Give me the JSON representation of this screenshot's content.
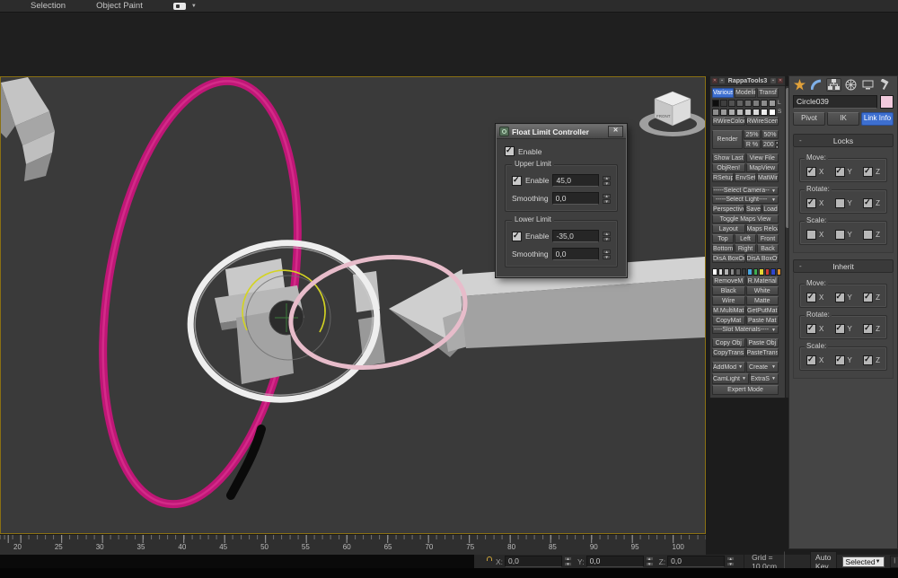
{
  "window": {
    "top_tabs": [
      "Selection",
      "Object Paint"
    ]
  },
  "icons": {
    "close": "✕",
    "caret_down": "▼",
    "spin_up": "▲",
    "spin_down": "▼",
    "minus": "-",
    "goto_start": "|◀◀",
    "prev_frame": "◀",
    "dot": "▪"
  },
  "viewport": {
    "viewcube_label": "FRONT"
  },
  "dialog": {
    "title": "Float Limit Controller",
    "enable": {
      "label": "Enable",
      "checked": true
    },
    "upper": {
      "title": "Upper Limit",
      "enable_label": "Enable",
      "enable_checked": true,
      "limit_value": "45,0",
      "smoothing_label": "Smoothing",
      "smoothing_value": "0,0"
    },
    "lower": {
      "title": "Lower Limit",
      "enable_label": "Enable",
      "enable_checked": true,
      "limit_value": "-35,0",
      "smoothing_label": "Smoothing",
      "smoothing_value": "0,0"
    }
  },
  "rappatools": {
    "title": "RappaTools3",
    "tabs": [
      {
        "label": "Various",
        "active": true
      },
      {
        "label": "Modeling",
        "active": false
      },
      {
        "label": "Transf",
        "active": false
      }
    ],
    "swatches_l": [
      "#0d0d0d",
      "#3f3f3f",
      "#525252",
      "#616161",
      "#6f6f6f",
      "#7d7d7d",
      "#8c8c8c",
      "#9b9b9b"
    ],
    "swatch_l_label": "L",
    "swatches_s": [
      "#8c8c8c",
      "#9b9b9b",
      "#ababab",
      "#bababa",
      "#cacaca",
      "#dadada",
      "#eeeeee",
      "#ffffff"
    ],
    "swatch_s_label": "S",
    "material_swatches": [
      "#ffffff",
      "#d9d9d9",
      "#b3b3b3",
      "#8c8c8c",
      "#5f5f5f",
      "#383838",
      "#4aa6dd",
      "#3fae53",
      "#e3d435",
      "#cf3a33",
      "#2f46cc",
      "#de8f2e"
    ],
    "buttons": {
      "rwirecolor": "RWireColor",
      "rwirescene": "RWireScene",
      "render": "Render",
      "p25": "25%",
      "p50": "50%",
      "rpct": "R %",
      "rvalue": "200",
      "show_last": "Show Last",
      "view_file": "View File",
      "objren": "ObjRen!",
      "mapview": "MapView",
      "rsetup": "RSetup",
      "envset": "EnvSet",
      "matwin": "MatWin",
      "select_camera": "-----Select Camera--",
      "select_light": "-----Select Light----",
      "perspective": "Perspective",
      "save": "Save",
      "load": "Load",
      "toggle_maps": "Toggle Maps View",
      "layout": "Layout",
      "maps_reload": "Maps Reload",
      "top": "Top",
      "left": "Left",
      "front": "Front",
      "bottom": "Bottom",
      "right": "Right",
      "back": "Back",
      "disa_on": "DisA BoxOn",
      "disa_off": "DisA BoxOff",
      "removem": "RemoveM",
      "rmaterial": "R.Material",
      "black": "Black",
      "white": "White",
      "wire": "Wire",
      "matte": "Matte",
      "mmultimat": "M.MultiMat",
      "getputmat": "GetPutMat",
      "copymat": "CopyMat",
      "pastemat": "Paste Mat",
      "slot_materials": "----Slot Materials----",
      "copyobj": "Copy Obj",
      "pasteobj": "Paste Obj",
      "copytrans": "CopyTrans",
      "pastetrans": "PasteTrans",
      "addmod": "AddMod",
      "create": "Create",
      "camlight": "CamLight",
      "extras": "ExtraS",
      "expert": "Expert Mode"
    }
  },
  "command_panel": {
    "object_name": "Circle039",
    "object_color": "#f2cadd",
    "pivot": "Pivot",
    "ik": "IK",
    "link_info": "Link Info",
    "axis_labels": {
      "x": "X",
      "y": "Y",
      "z": "Z"
    },
    "locks": {
      "title": "Locks",
      "move": {
        "label": "Move:",
        "x": true,
        "y": true,
        "z": true
      },
      "rotate": {
        "label": "Rotate:",
        "x": true,
        "y": false,
        "z": true
      },
      "scale": {
        "label": "Scale:",
        "x": false,
        "y": false,
        "z": false
      }
    },
    "inherit": {
      "title": "Inherit",
      "move": {
        "label": "Move:",
        "x": true,
        "y": true,
        "z": true
      },
      "rotate": {
        "label": "Rotate:",
        "x": true,
        "y": true,
        "z": true
      },
      "scale": {
        "label": "Scale:",
        "x": true,
        "y": true,
        "z": true
      }
    }
  },
  "timeline": {
    "labels": [
      "20",
      "25",
      "30",
      "35",
      "40",
      "45",
      "50",
      "55",
      "60",
      "65",
      "70",
      "75",
      "80",
      "85",
      "90",
      "95",
      "100"
    ]
  },
  "status_bar": {
    "x_label": "X:",
    "x_value": "0,0",
    "y_label": "Y:",
    "y_value": "0,0",
    "z_label": "Z:",
    "z_value": "0,0",
    "grid": "Grid = 10,0cm",
    "auto_key": "Auto Key",
    "time_filter": "Selected"
  },
  "colors": {
    "accent_blue": "#3d6fd0",
    "viewport_border": "#8a7013",
    "magenta_spline": "#c01677",
    "selected_circle_white": "#eeeeee",
    "pink_circle": "#e7bcca",
    "gizmo_yellow": "#d4d422"
  }
}
